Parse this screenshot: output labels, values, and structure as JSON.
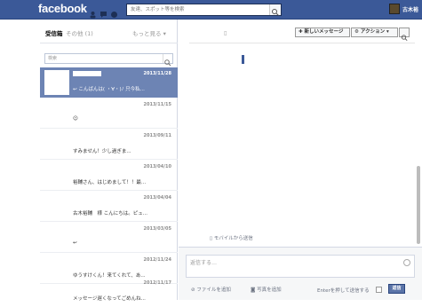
{
  "header": {
    "logo": "facebook",
    "search_placeholder": "友達、スポット等を検索",
    "user_name": "古木裕"
  },
  "sidebar": {
    "tabs": {
      "inbox": "受信箱",
      "other": "その他 (1)",
      "more": "もっと見る ▾"
    },
    "search_placeholder": "検索",
    "threads": [
      {
        "date": "2013/11/28",
        "snippet": "↩ こんばんは( ・∀・)ﾉ 只今私..."
      },
      {
        "date": "2013/11/15",
        "snippet": "☺"
      },
      {
        "date": "2013/09/11",
        "snippet": "すみません！少し過ぎま..."
      },
      {
        "date": "2013/04/10",
        "snippet": "裕輔さん、はじめまして！！最..."
      },
      {
        "date": "2013/04/04",
        "snippet": "古木裕輔　様 こんにちは。ピュ..."
      },
      {
        "date": "2013/03/05",
        "snippet": "↩"
      },
      {
        "date": "2012/11/24",
        "snippet": "ゆうすけくん！来てくれて、あ..."
      },
      {
        "date": "2012/11/17",
        "snippet": "メッセージ遅くなってごめんね..."
      }
    ]
  },
  "conversation": {
    "new_message_label": "✚ 新しいメッセージ",
    "action_label": "⚙ アクション ▾",
    "sent_from": "▯ モバイルから送信"
  },
  "composer": {
    "placeholder": "返信する…",
    "attach_label": "⊘ ファイルを追加",
    "photo_label": "◙ 写真を追加",
    "enter_label": "Enterを押して送信する",
    "reply_label": "返信"
  },
  "colors": {
    "brand": "#3b5998",
    "selected_row": "#6d84b4"
  }
}
